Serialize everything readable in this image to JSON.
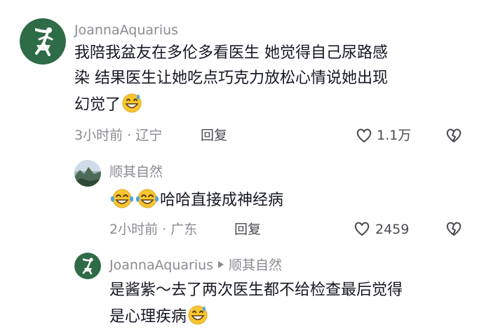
{
  "comments": [
    {
      "username": "JoannaAquarius",
      "content_line1": "我陪我盆友在多伦多看医生 她觉得自己尿路感",
      "content_line2": "染 结果医生让她吃点巧克力放松心情说她出现",
      "content_line3": "幻觉了",
      "time_location": "3小时前 · 辽宁",
      "reply_label": "回复",
      "likes": "1.1万"
    },
    {
      "username": "顺其自然",
      "content_line1": "哈哈直接成神经病",
      "time_location": "2小时前 · 广东",
      "reply_label": "回复",
      "likes": "2459"
    },
    {
      "username": "JoannaAquarius",
      "reply_to": "顺其自然",
      "content_line1": "是酱紫～去了两次医生都不给检查最后觉得",
      "content_line2": "是心理疾病"
    }
  ],
  "icons": {
    "like": "heart-outline-icon",
    "dislike": "broken-heart-icon",
    "reply_arrow": "triangle-right-icon",
    "sweat_smile": "sweat-smile-emoji",
    "laugh_cry": "tears-of-joy-emoji"
  },
  "colors": {
    "text_primary": "#161823",
    "text_secondary": "#8a8b91",
    "avatar_bg": "#2e6b47",
    "emoji_yellow": "#f7c531",
    "emoji_blue": "#4aa3e8"
  }
}
